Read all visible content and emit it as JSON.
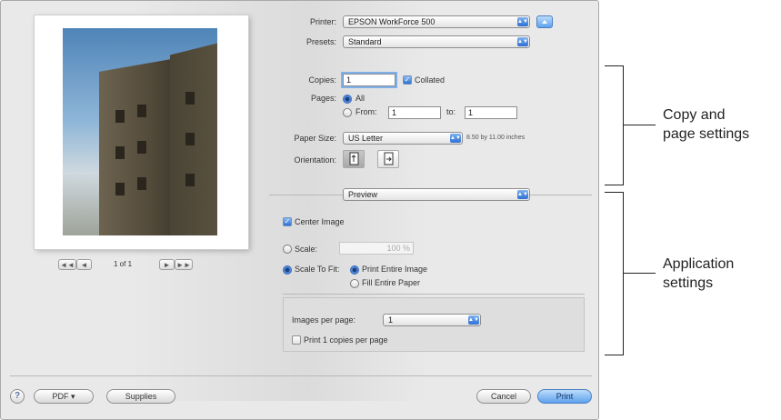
{
  "preview": {
    "page_indicator": "1 of 1",
    "first_label": "◄◄",
    "prev_label": "◄",
    "next_label": "►",
    "last_label": "►►"
  },
  "printer": {
    "label": "Printer:",
    "value": "EPSON WorkForce 500"
  },
  "presets": {
    "label": "Presets:",
    "value": "Standard"
  },
  "copies": {
    "label": "Copies:",
    "value": "1",
    "collated_label": "Collated",
    "collated": true
  },
  "pages": {
    "label": "Pages:",
    "all_label": "All",
    "from_label": "From:",
    "from_value": "1",
    "to_label": "to:",
    "to_value": "1",
    "selected": "All"
  },
  "paper_size": {
    "label": "Paper Size:",
    "value": "US Letter",
    "dimensions": "8.50 by 11.00 inches"
  },
  "orientation": {
    "label": "Orientation:",
    "selected": "portrait"
  },
  "section_popup": {
    "value": "Preview"
  },
  "application": {
    "center_image_label": "Center Image",
    "center_image": true,
    "scale_label": "Scale:",
    "scale_value": "100 %",
    "scale_to_fit_label": "Scale To Fit:",
    "print_entire_image_label": "Print Entire Image",
    "fill_entire_paper_label": "Fill Entire Paper",
    "images_per_page_label": "Images per page:",
    "images_per_page_value": "1",
    "print_copies_label": "Print 1 copies per page",
    "print_copies": false
  },
  "bottom": {
    "help_label": "?",
    "pdf_label": "PDF ▾",
    "supplies_label": "Supplies",
    "cancel_label": "Cancel",
    "print_label": "Print"
  },
  "callouts": {
    "copy_settings": "Copy and\npage settings",
    "application_settings": "Application\nsettings"
  },
  "colors": {
    "accent": "#2d6fd4",
    "dialog_bg": "#e9e9e9"
  }
}
